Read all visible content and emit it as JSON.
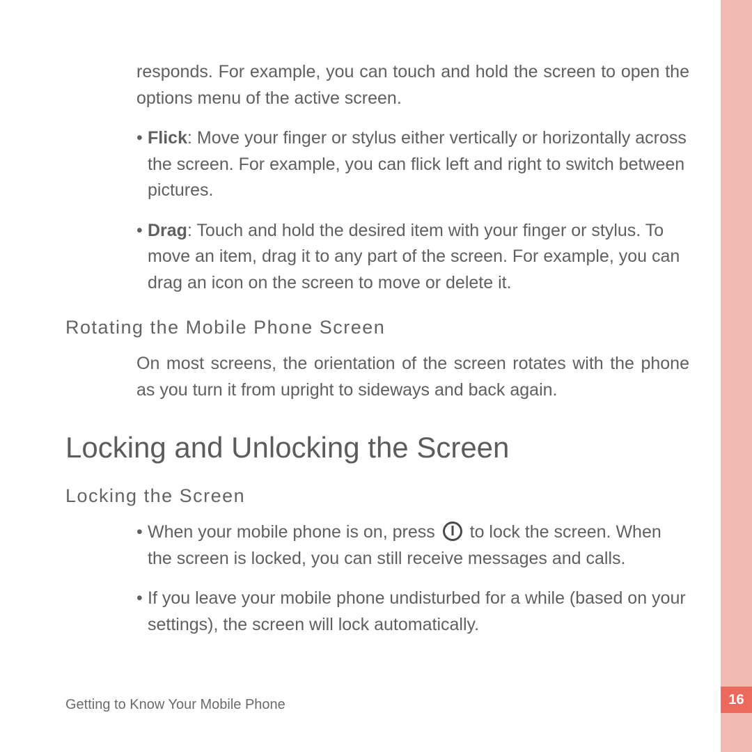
{
  "page_number": "16",
  "footer": "Getting to Know Your Mobile Phone",
  "intro_paragraph": "responds. For example, you can touch and hold the screen to open the options menu of the active screen.",
  "bullets_top": [
    {
      "term": "Flick",
      "text": ": Move your finger or stylus either vertically or horizontally across the screen. For example, you can flick left and right to switch between pictures."
    },
    {
      "term": "Drag",
      "text": ": Touch and hold the desired item with your finger or stylus. To move an item, drag it to any part of the screen. For example, you can drag an icon on the screen to move or delete it."
    }
  ],
  "subhead_rotate": "Rotating the Mobile Phone Screen",
  "rotate_body": "On most screens, the orientation of the screen rotates with the phone as you turn it from upright to sideways and back again.",
  "section_heading": "Locking and Unlocking the Screen",
  "subhead_lock": "Locking the Screen",
  "lock_bullets": {
    "first_pre": "When your mobile phone is on, press ",
    "first_post": " to lock the screen. When the screen is locked, you can still receive messages and calls.",
    "second": "If you leave your mobile phone undisturbed for a while (based on your settings), the screen will lock automatically."
  }
}
